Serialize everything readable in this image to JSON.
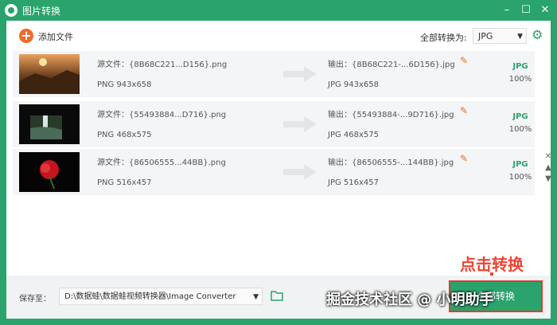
{
  "window": {
    "title": "图片转换",
    "minimize": "–",
    "maximize": "☐",
    "close": "✕"
  },
  "toolbar": {
    "add_files_icon": "plus-icon",
    "add_files_label": "添加文件",
    "convert_all_label": "全部转换为:",
    "format_value": "JPG"
  },
  "files": [
    {
      "source_name": "源文件：{8B68C221...D156}.png",
      "source_info": "PNG   943x658",
      "output_name": "输出：{8B68C221-...6D156}.jpg",
      "output_info": "JPG   943x658",
      "format": "JPG",
      "progress": "100%"
    },
    {
      "source_name": "源文件：{55493884...D716}.png",
      "source_info": "PNG   468x575",
      "output_name": "输出：{55493884-...9D716}.jpg",
      "output_info": "JPG   468x575",
      "format": "JPG",
      "progress": "100%"
    },
    {
      "source_name": "源文件：{86506555...44BB}.png",
      "source_info": "PNG   516x457",
      "output_name": "输出：{86506555-...144BB}.jpg",
      "output_info": "JPG   516x457",
      "format": "JPG",
      "progress": "100%"
    }
  ],
  "row_tools": {
    "close": "✕",
    "up": "▲",
    "down": "▼"
  },
  "annotation": "点击转换",
  "bottom": {
    "save_label": "保存至：",
    "save_path": "D:\\数据蛙\\数据蛙视频转换器\\Image Converter",
    "convert_button": "全部转换"
  },
  "watermark": "掘金技术社区 @ 小明助手"
}
